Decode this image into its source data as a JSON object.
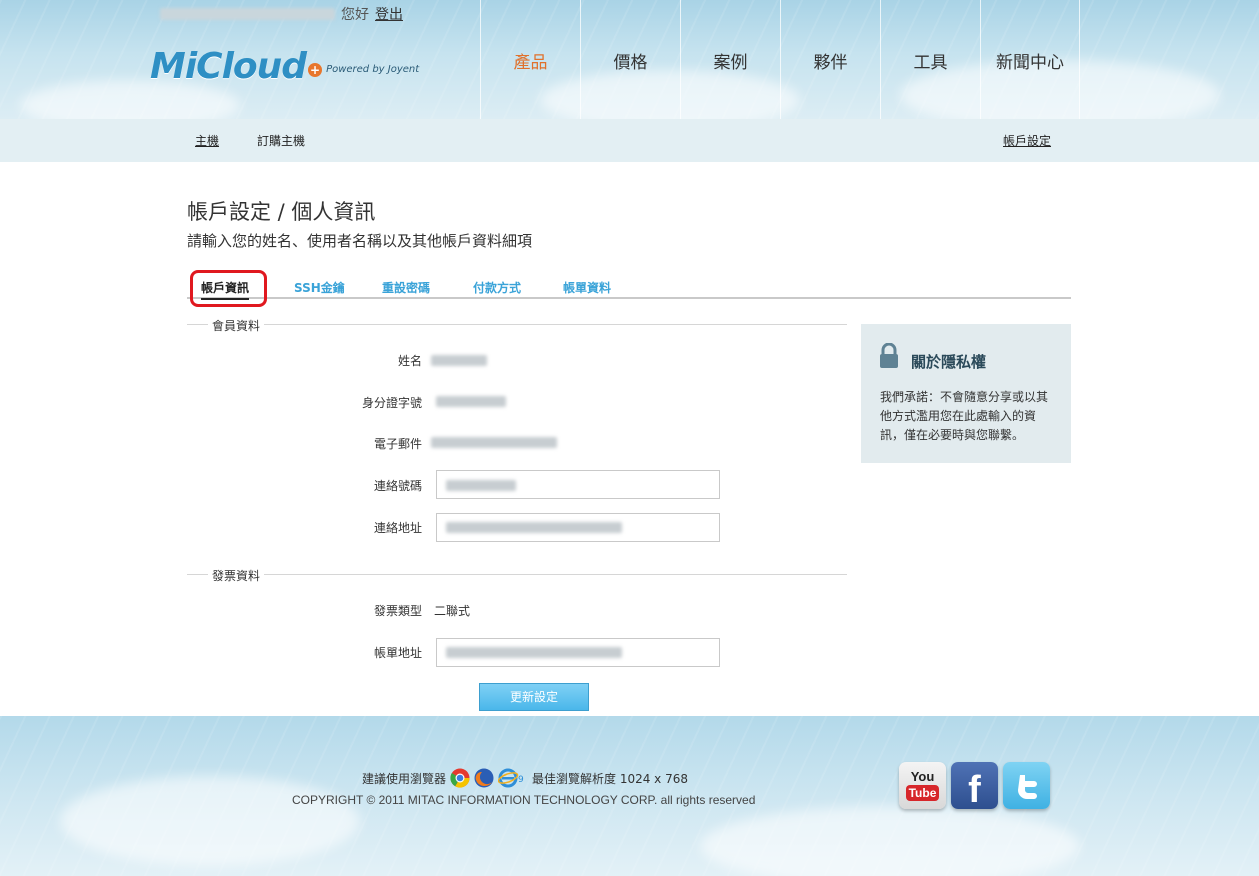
{
  "header": {
    "greeting": "您好",
    "logout_label": "登出",
    "logo_text": "MiCloud",
    "logo_plus": "+",
    "powered_by": "Powered by Joyent",
    "nav": [
      "產品",
      "價格",
      "案例",
      "夥伴",
      "工具",
      "新聞中心"
    ],
    "active_nav": "產品"
  },
  "subnav": {
    "host": "主機",
    "order_host": "訂購主機",
    "account_settings": "帳戶設定"
  },
  "main": {
    "title": "帳戶設定 / 個人資訊",
    "subtitle": "請輸入您的姓名、使用者名稱以及其他帳戶資料細項",
    "tabs": [
      "帳戶資訊",
      "SSH金鑰",
      "重設密碼",
      "付款方式",
      "帳單資料"
    ],
    "active_tab": "帳戶資訊",
    "member_section": {
      "label": "會員資料",
      "name_label": "姓名",
      "id_label": "身分證字號",
      "email_label": "電子郵件",
      "phone_label": "連絡號碼",
      "address_label": "連絡地址"
    },
    "invoice_section": {
      "label": "發票資料",
      "type_label": "發票類型",
      "type_value": "二聯式",
      "billing_address_label": "帳單地址"
    },
    "submit_label": "更新設定"
  },
  "privacy": {
    "title": "關於隱私權",
    "text": "我們承諾：不會隨意分享或以其他方式濫用您在此處輸入的資訊，僅在必要時與您聯繫。"
  },
  "footer": {
    "browser_prefix": "建議使用瀏覽器",
    "resolution_text": "最佳瀏覽解析度 1024 x 768",
    "ie_version": "9",
    "copyright": "COPYRIGHT © 2011 MITAC INFORMATION TECHNOLOGY CORP. all rights reserved",
    "youtube_label_top": "You",
    "youtube_label_bottom": "Tube",
    "facebook_label": "f"
  },
  "colors": {
    "accent_blue": "#3aa3d8",
    "nav_active": "#e0712c",
    "highlight_red": "#e0181f"
  }
}
